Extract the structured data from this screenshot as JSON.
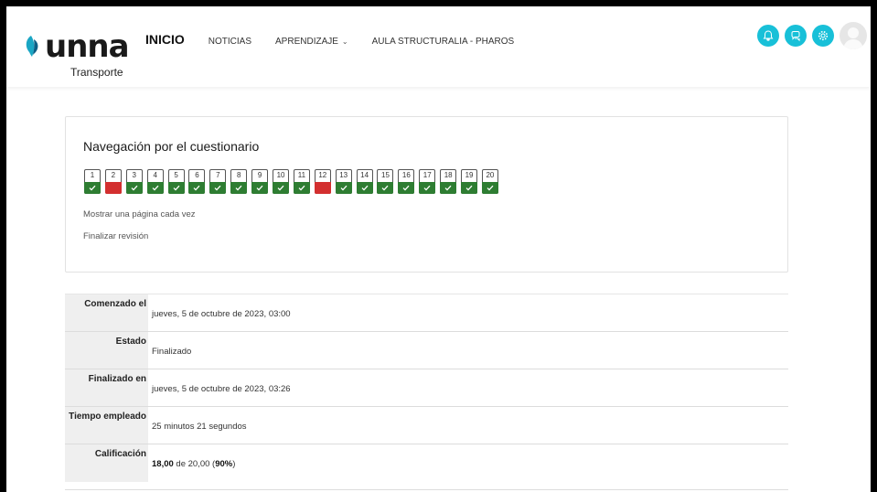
{
  "brand": {
    "logo_text": "unna",
    "logo_sub": "Transporte"
  },
  "nav": {
    "items": [
      {
        "label": "INICIO",
        "active": true
      },
      {
        "label": "NOTICIAS",
        "active": false
      },
      {
        "label": "APRENDIZAJE",
        "active": false,
        "dropdown": true
      },
      {
        "label": "AULA STRUCTURALIA - PHAROS",
        "active": false
      }
    ]
  },
  "header_icons": [
    "notifications-icon",
    "messages-icon",
    "settings-icon",
    "user-avatar"
  ],
  "accent_color": "#18c0d8",
  "quiz_nav": {
    "title": "Navegación por el cuestionario",
    "questions": [
      {
        "n": "1",
        "state": "correct"
      },
      {
        "n": "2",
        "state": "wrong"
      },
      {
        "n": "3",
        "state": "correct"
      },
      {
        "n": "4",
        "state": "correct"
      },
      {
        "n": "5",
        "state": "correct"
      },
      {
        "n": "6",
        "state": "correct"
      },
      {
        "n": "7",
        "state": "correct"
      },
      {
        "n": "8",
        "state": "correct"
      },
      {
        "n": "9",
        "state": "correct"
      },
      {
        "n": "10",
        "state": "correct"
      },
      {
        "n": "11",
        "state": "correct"
      },
      {
        "n": "12",
        "state": "wrong"
      },
      {
        "n": "13",
        "state": "correct"
      },
      {
        "n": "14",
        "state": "correct"
      },
      {
        "n": "15",
        "state": "correct"
      },
      {
        "n": "16",
        "state": "correct"
      },
      {
        "n": "17",
        "state": "correct"
      },
      {
        "n": "18",
        "state": "correct"
      },
      {
        "n": "19",
        "state": "correct"
      },
      {
        "n": "20",
        "state": "correct"
      }
    ],
    "show_one_page": "Mostrar una página cada vez",
    "finish_review": "Finalizar revisión"
  },
  "status_colors": {
    "correct": "#2e7d32",
    "wrong": "#d32f2f"
  },
  "summary": {
    "rows": [
      {
        "label": "Comenzado el",
        "value": "jueves, 5 de octubre de 2023, 03:00"
      },
      {
        "label": "Estado",
        "value": "Finalizado"
      },
      {
        "label": "Finalizado en",
        "value": "jueves, 5 de octubre de 2023, 03:26"
      },
      {
        "label": "Tiempo empleado",
        "value": "25 minutos 21 segundos"
      }
    ],
    "grade": {
      "label": "Calificación",
      "score": "18,00",
      "of_text": " de 20,00 (",
      "percent": "90%",
      "close": ")"
    }
  }
}
